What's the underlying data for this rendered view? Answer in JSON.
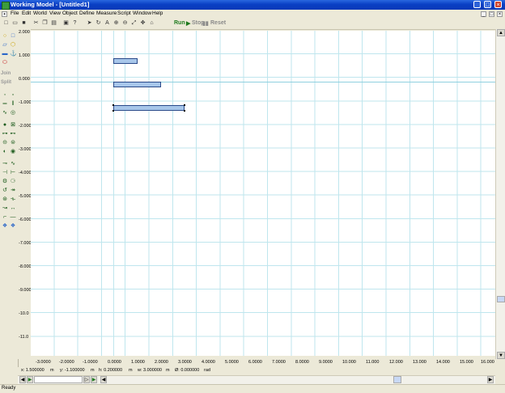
{
  "window": {
    "title": "Working Model - [Untitled1]"
  },
  "menu": [
    "File",
    "Edit",
    "World",
    "View",
    "Object",
    "Define",
    "Measure",
    "Script",
    "Window",
    "Help"
  ],
  "toolbar": {
    "run": "Run",
    "stop": "Stop",
    "reset": "Reset"
  },
  "palette": {
    "join": "Join",
    "split": "Split"
  },
  "ruler": {
    "y_labels": [
      "2.000",
      "1.000",
      "0.000",
      "-1.000",
      "-2.000",
      "-3.000",
      "-4.000",
      "-5.000",
      "-6.000",
      "-7.000",
      "-8.000",
      "-9.000",
      "-10.0",
      "-11.0"
    ],
    "x_labels": [
      "-3.0000",
      "-2.0000",
      "-1.0000",
      "0.0000",
      "1.0000",
      "2.0000",
      "3.0000",
      "4.0000",
      "5.0000",
      "6.0000",
      "7.0000",
      "8.0000",
      "9.0000",
      "10.000",
      "11.000",
      "12.000",
      "13.000",
      "14.000",
      "15.000",
      "16.000"
    ]
  },
  "coords": {
    "x": "x: 1.500000",
    "x_unit": "m",
    "y": "y: -1.100000",
    "y_unit": "m",
    "h": "h: 0.200000",
    "h_unit": "m",
    "w": "w: 3.000000",
    "w_unit": "m",
    "angle": "Ø: 0.000000",
    "angle_unit": "rad"
  },
  "status": "Ready"
}
